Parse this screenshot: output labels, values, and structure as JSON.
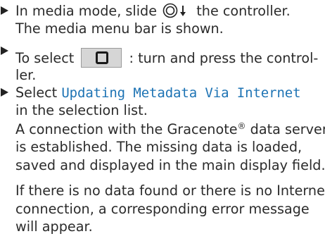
{
  "step1": {
    "line1_before": "In media mode, slide",
    "icon": "controller-slide-down-icon",
    "line1_after": "the controller.",
    "line2": "The media menu bar is shown."
  },
  "step2": {
    "line1_before": "To select",
    "icon": "media-symbol-button-icon",
    "line1_after": ": turn and press the control-",
    "line2": "ler."
  },
  "step3": {
    "line1_before": "Select",
    "menu_item": "Updating Metadata Via Internet",
    "line2": "in the selection list.",
    "result_line1_before": "A connection with the Gracenote",
    "registered": "®",
    "result_line1_after": "data server",
    "result_line2": "is established. The missing data is loaded,",
    "result_line3": "saved and displayed in the main display field.",
    "error_line1": "If there is no data found or there is no Internet",
    "error_line2": "connection, a corresponding error message",
    "error_line3": "will appear."
  }
}
